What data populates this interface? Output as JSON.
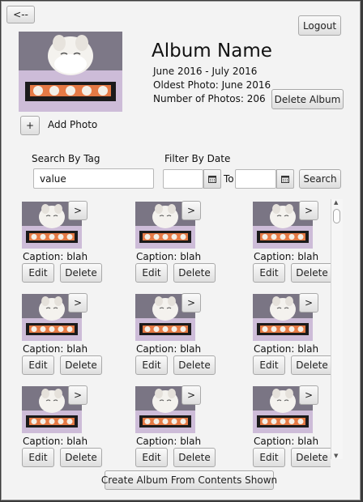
{
  "nav": {
    "back_label": "<--"
  },
  "header": {
    "logout_label": "Logout",
    "album_name": "Album Name",
    "date_range": "June 2016 - July 2016",
    "oldest_photo": "Oldest Photo: June 2016",
    "photo_count": "Number of Photos: 206",
    "delete_album_label": "Delete Album",
    "add_photo_button": "+",
    "add_photo_label": "Add Photo"
  },
  "search": {
    "tag_label": "Search  By Tag",
    "tag_value": "value",
    "date_label": "Filter By Date",
    "to_label": "To",
    "search_button": "Search"
  },
  "photos": [
    {
      "caption": "Caption: blah",
      "edit": "Edit",
      "delete": "Delete",
      "open": ">"
    },
    {
      "caption": "Caption: blah",
      "edit": "Edit",
      "delete": "Delete",
      "open": ">"
    },
    {
      "caption": "Caption: blah",
      "edit": "Edit",
      "delete": "Delete",
      "open": ">"
    },
    {
      "caption": "Caption: blah",
      "edit": "Edit",
      "delete": "Delete",
      "open": ">"
    },
    {
      "caption": "Caption: blah",
      "edit": "Edit",
      "delete": "Delete",
      "open": ">"
    },
    {
      "caption": "Caption: blah",
      "edit": "Edit",
      "delete": "Delete",
      "open": ">"
    },
    {
      "caption": "Caption: blah",
      "edit": "Edit",
      "delete": "Delete",
      "open": ">"
    },
    {
      "caption": "Caption: blah",
      "edit": "Edit",
      "delete": "Delete",
      "open": ">"
    },
    {
      "caption": "Caption: blah",
      "edit": "Edit",
      "delete": "Delete",
      "open": ">"
    }
  ],
  "footer": {
    "create_album_label": "Create Album From Contents Shown"
  }
}
